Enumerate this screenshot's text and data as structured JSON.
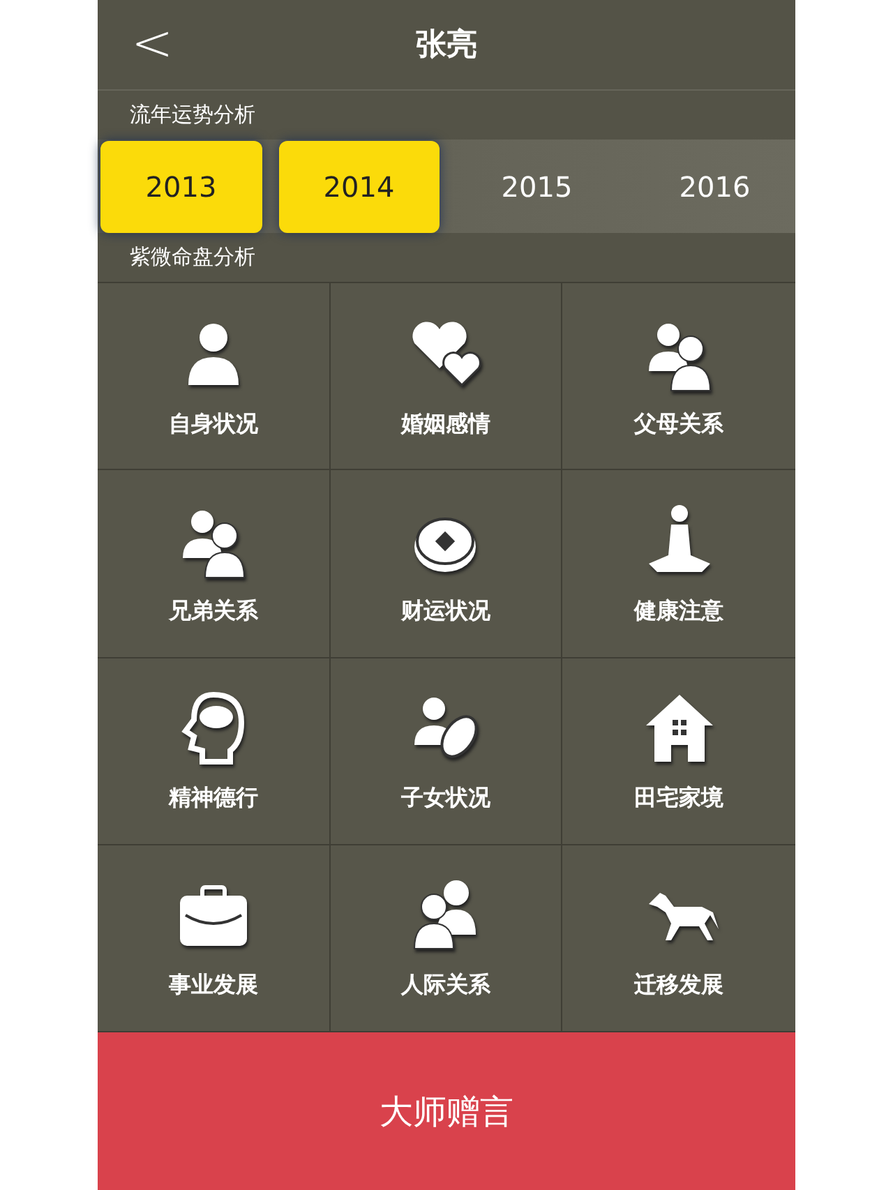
{
  "header": {
    "back": "<",
    "title": "张亮"
  },
  "year_section": {
    "label": "流年运势分析",
    "years": [
      {
        "label": "2013",
        "selected": true
      },
      {
        "label": "2014",
        "selected": true
      },
      {
        "label": "2015",
        "selected": false
      },
      {
        "label": "2016",
        "selected": false
      }
    ]
  },
  "chart_section": {
    "label": "紫微命盘分析",
    "items": [
      {
        "label": "自身状况"
      },
      {
        "label": "婚姻感情"
      },
      {
        "label": "父母关系"
      },
      {
        "label": "兄弟关系"
      },
      {
        "label": "财运状况"
      },
      {
        "label": "健康注意"
      },
      {
        "label": "精神德行"
      },
      {
        "label": "子女状况"
      },
      {
        "label": "田宅家境"
      },
      {
        "label": "事业发展"
      },
      {
        "label": "人际关系"
      },
      {
        "label": "迁移发展"
      }
    ]
  },
  "bottom_button": {
    "label": "大师赠言"
  }
}
